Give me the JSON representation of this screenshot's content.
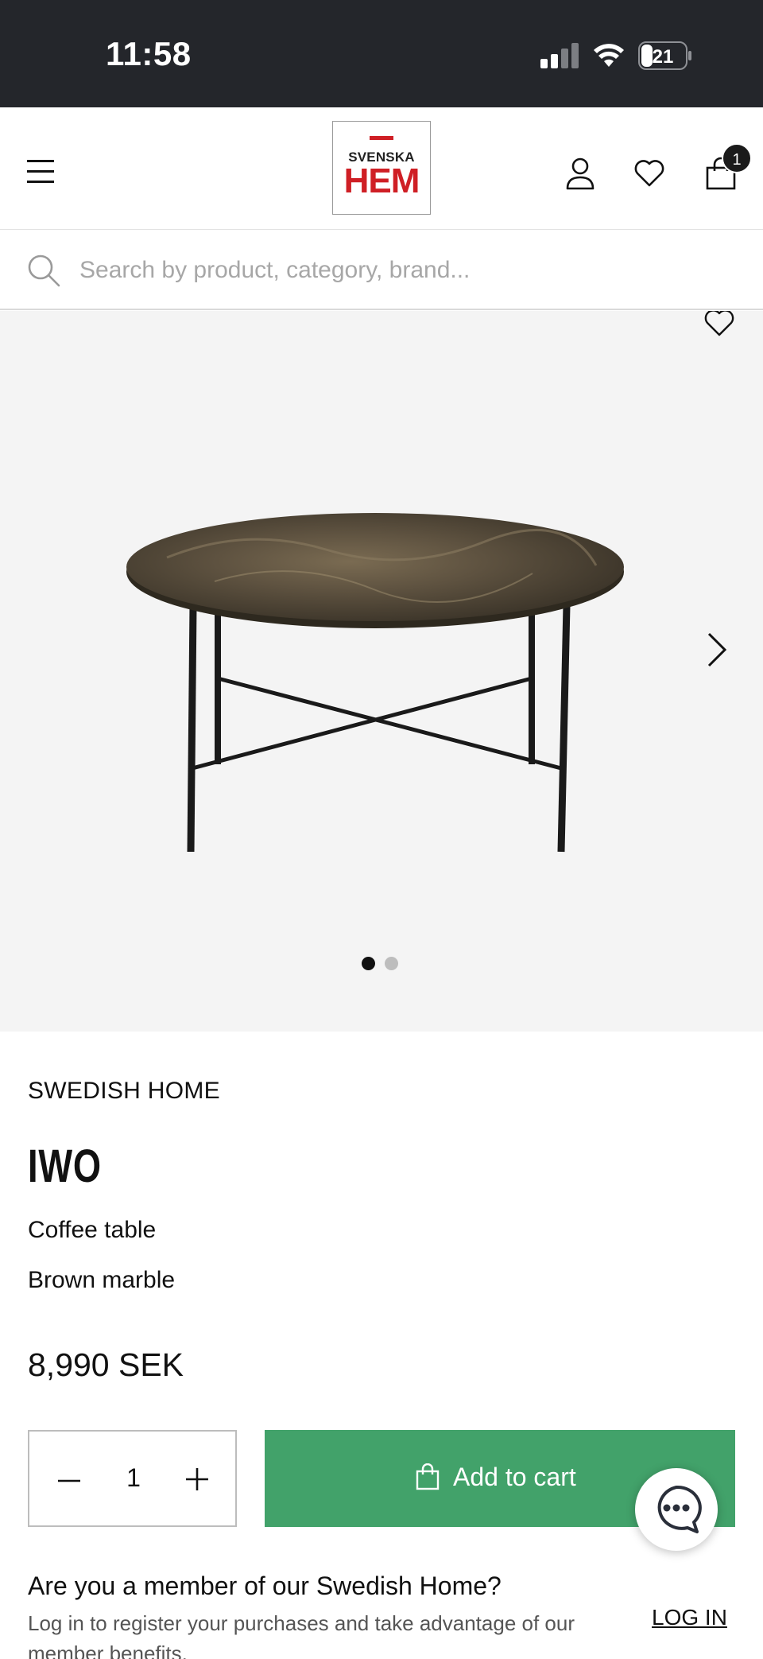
{
  "status_bar": {
    "time": "11:58",
    "battery": "21"
  },
  "header": {
    "logo_top": "SVENSKA",
    "logo_bottom": "HEM",
    "cart_count": "1"
  },
  "search": {
    "placeholder": "Search by product, category, brand..."
  },
  "gallery": {
    "current_slide": 1,
    "total_slides": 2
  },
  "product": {
    "brand": "SWEDISH HOME",
    "name": "IWO",
    "type": "Coffee table",
    "material": "Brown marble",
    "price": "8,990 SEK"
  },
  "purchase": {
    "quantity": "1",
    "add_to_cart_label": "Add to cart"
  },
  "member": {
    "title": "Are you a member of our Swedish Home?",
    "text": "Log in to register your purchases and take advantage of our member benefits.",
    "login_label": "LOG IN"
  },
  "colors": {
    "accent_green": "#42a26a",
    "brand_red": "#cf1f25",
    "status_bar_bg": "#24262b"
  }
}
